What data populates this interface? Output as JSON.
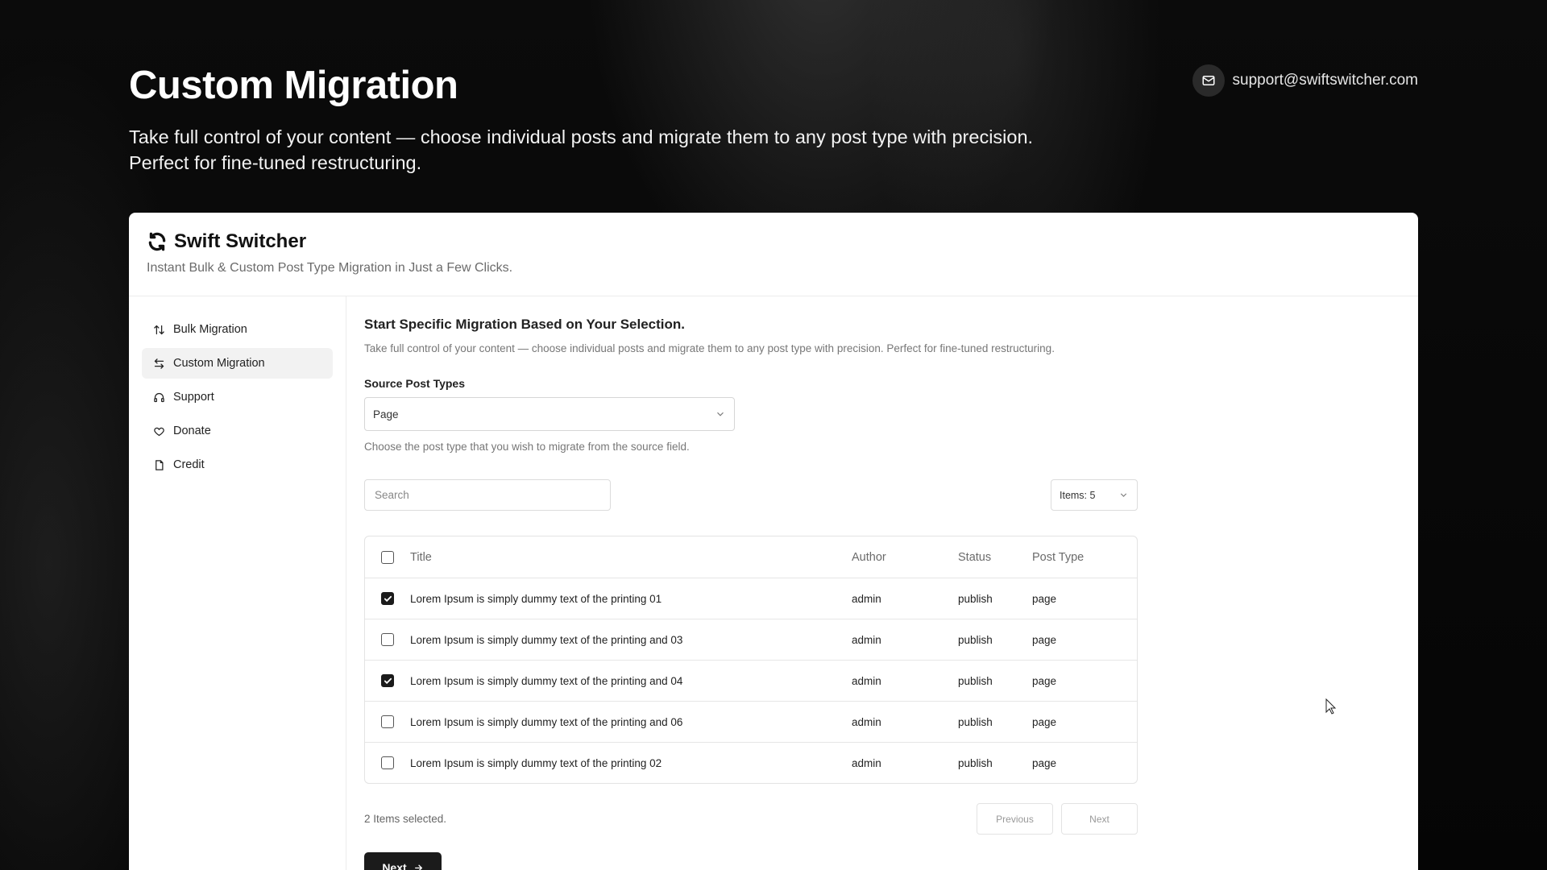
{
  "hero": {
    "title": "Custom Migration",
    "description_line1": "Take full control of your content — choose individual posts and migrate them to any post type with precision.",
    "description_line2": "Perfect for fine-tuned restructuring.",
    "support_email": "support@swiftswitcher.com"
  },
  "app": {
    "brand": "Swift Switcher",
    "tagline": "Instant Bulk & Custom Post Type Migration in Just a Few Clicks."
  },
  "sidebar": {
    "items": [
      {
        "label": "Bulk Migration",
        "icon": "arrows-up-down-icon"
      },
      {
        "label": "Custom Migration",
        "icon": "arrows-left-right-icon",
        "active": true
      },
      {
        "label": "Support",
        "icon": "headphones-icon"
      },
      {
        "label": "Donate",
        "icon": "heart-icon"
      },
      {
        "label": "Credit",
        "icon": "file-icon"
      }
    ]
  },
  "main": {
    "title": "Start Specific Migration Based on Your Selection.",
    "description": "Take full control of your content — choose individual posts and migrate them to any post type with precision. Perfect for fine-tuned restructuring.",
    "source_label": "Source Post Types",
    "source_value": "Page",
    "source_help": "Choose the post type that you wish to migrate from the source field.",
    "search_placeholder": "Search",
    "items_per_page": "Items: 5"
  },
  "table": {
    "headers": {
      "title": "Title",
      "author": "Author",
      "status": "Status",
      "post_type": "Post Type"
    },
    "rows": [
      {
        "title": "Lorem Ipsum is simply dummy text of the printing 01",
        "author": "admin",
        "status": "publish",
        "post_type": "page",
        "checked": true
      },
      {
        "title": "Lorem Ipsum is simply dummy text of the printing and 03",
        "author": "admin",
        "status": "publish",
        "post_type": "page",
        "checked": false
      },
      {
        "title": "Lorem Ipsum is simply dummy text of the printing and 04",
        "author": "admin",
        "status": "publish",
        "post_type": "page",
        "checked": true
      },
      {
        "title": "Lorem Ipsum is simply dummy text of the printing and 06",
        "author": "admin",
        "status": "publish",
        "post_type": "page",
        "checked": false
      },
      {
        "title": "Lorem Ipsum is simply dummy text of the printing 02",
        "author": "admin",
        "status": "publish",
        "post_type": "page",
        "checked": false
      }
    ]
  },
  "footer": {
    "selected_text": "2 Items selected.",
    "previous_label": "Previous",
    "next_page_label": "Next",
    "next_button_label": "Next"
  },
  "colors": {
    "accent": "#1b1b1b",
    "background": "#000000",
    "card": "#ffffff"
  }
}
